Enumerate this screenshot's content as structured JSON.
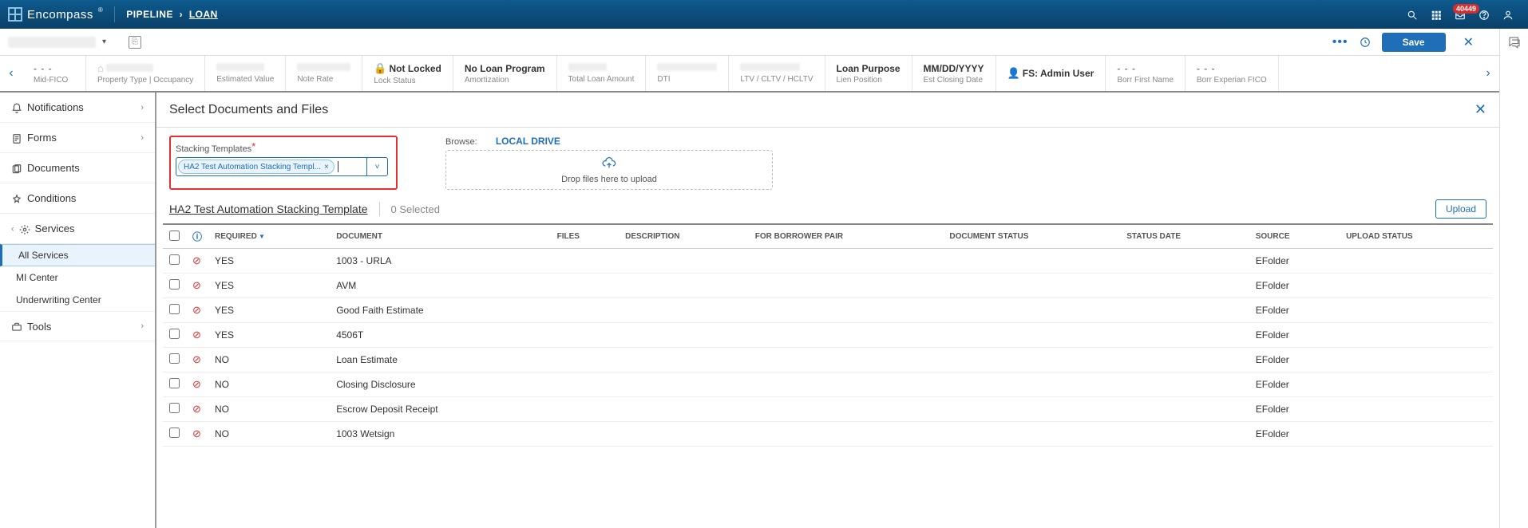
{
  "header": {
    "brand": "Encompass",
    "crumb1": "PIPELINE",
    "crumb2": "LOAN",
    "badge": "40449"
  },
  "subbar": {
    "save": "Save"
  },
  "info_cells": [
    {
      "value": "- - -",
      "label": "Mid-FICO"
    },
    {
      "value": "",
      "label": "Property Type | Occupancy",
      "blurred": true,
      "icon": "home"
    },
    {
      "value": "",
      "label": "Estimated Value",
      "blurred": true
    },
    {
      "value": "",
      "label": "Note Rate",
      "blurred": true
    },
    {
      "value": "Not Locked",
      "label": "Lock Status",
      "icon": "lock"
    },
    {
      "value": "No Loan Program",
      "label": "Amortization"
    },
    {
      "value": "",
      "label": "Total Loan Amount",
      "blurred": true
    },
    {
      "value": "",
      "label": "DTI",
      "blurred": true
    },
    {
      "value": "",
      "label": "LTV / CLTV / HCLTV",
      "blurred": true
    },
    {
      "value": "Loan Purpose",
      "label": "Lien Position"
    },
    {
      "value": "MM/DD/YYYY",
      "label": "Est Closing Date"
    },
    {
      "value": "FS: Admin User",
      "label": "",
      "icon": "person"
    },
    {
      "value": "- - -",
      "label": "Borr First Name"
    },
    {
      "value": "- - -",
      "label": "Borr Experian FICO"
    }
  ],
  "sidebar": {
    "notifications": "Notifications",
    "forms": "Forms",
    "documents": "Documents",
    "conditions": "Conditions",
    "services": "Services",
    "all_services": "All Services",
    "mi_center": "MI Center",
    "uw_center": "Underwriting Center",
    "tools": "Tools"
  },
  "panel": {
    "title": "Select Documents and Files",
    "stk_label": "Stacking Templates",
    "stk_chip": "HA2 Test Automation Stacking Templ...",
    "browse_label": "Browse:",
    "local_drive": "LOCAL DRIVE",
    "drop_text": "Drop files here to upload",
    "template_name": "HA2 Test Automation Stacking Template",
    "selected_text": "0 Selected",
    "upload": "Upload"
  },
  "columns": {
    "required": "REQUIRED",
    "document": "DOCUMENT",
    "files": "FILES",
    "description": "DESCRIPTION",
    "for_borrower": "FOR BORROWER PAIR",
    "doc_status": "DOCUMENT STATUS",
    "status_date": "STATUS DATE",
    "source": "SOURCE",
    "upload_status": "UPLOAD STATUS"
  },
  "rows": [
    {
      "req": "YES",
      "doc": "1003 - URLA",
      "source": "EFolder"
    },
    {
      "req": "YES",
      "doc": "AVM",
      "source": "EFolder"
    },
    {
      "req": "YES",
      "doc": "Good Faith Estimate",
      "source": "EFolder"
    },
    {
      "req": "YES",
      "doc": "4506T",
      "source": "EFolder"
    },
    {
      "req": "NO",
      "doc": "Loan Estimate",
      "source": "EFolder"
    },
    {
      "req": "NO",
      "doc": "Closing Disclosure",
      "source": "EFolder"
    },
    {
      "req": "NO",
      "doc": "Escrow Deposit Receipt",
      "source": "EFolder"
    },
    {
      "req": "NO",
      "doc": "1003 Wetsign",
      "source": "EFolder"
    }
  ]
}
